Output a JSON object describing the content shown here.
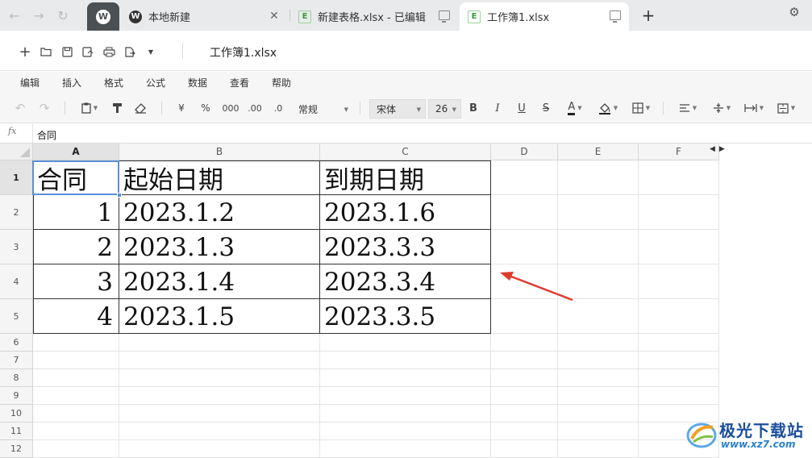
{
  "tabs": {
    "items": [
      {
        "label": "本地新建",
        "icon": "app-logo-icon"
      },
      {
        "label": "新建表格.xlsx - 已编辑",
        "icon": "xlsx-icon"
      },
      {
        "label": "工作簿1.xlsx",
        "icon": "xlsx-icon",
        "active": true
      }
    ],
    "xls_glyph": "E",
    "logo_glyph": "W"
  },
  "file_toolbar": {
    "doc_title": "工作簿1.xlsx"
  },
  "menu": {
    "items": [
      "编辑",
      "插入",
      "格式",
      "公式",
      "数据",
      "查看",
      "帮助"
    ]
  },
  "format_toolbar": {
    "currency": "¥",
    "percent": "%",
    "thousands": "000",
    "decimal_inc": ".00",
    "decimal_dec": ".0",
    "number_format": "常规",
    "font_name": "宋体",
    "font_size": "26",
    "bold": "B",
    "italic": "I",
    "underline": "U",
    "strike": "S",
    "font_color": "A"
  },
  "formula_bar": {
    "fx_label": "fx",
    "value": "合同"
  },
  "grid": {
    "columns": [
      "A",
      "B",
      "C",
      "D",
      "E",
      "F"
    ],
    "rows": [
      "1",
      "2",
      "3",
      "4",
      "5",
      "6",
      "7",
      "8",
      "9",
      "10",
      "11",
      "12"
    ],
    "selected_cell": "A1",
    "header_row": [
      "合同",
      "起始日期",
      "到期日期"
    ],
    "data_rows": [
      [
        "1",
        "2023.1.2",
        "2023.1.6"
      ],
      [
        "2",
        "2023.1.3",
        "2023.3.3"
      ],
      [
        "3",
        "2023.1.4",
        "2023.3.4"
      ],
      [
        "4",
        "2023.1.5",
        "2023.3.5"
      ]
    ]
  },
  "annotation": {
    "arrow_color": "#e03a2f"
  },
  "watermark": {
    "title": "极光下载站",
    "url": "www.xz7.com"
  }
}
